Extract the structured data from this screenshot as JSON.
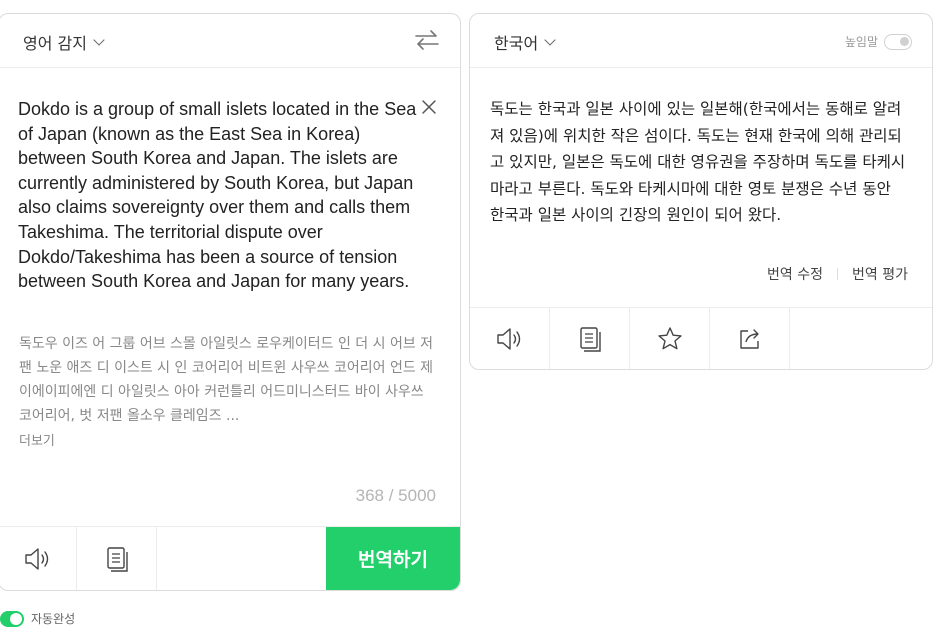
{
  "source_panel": {
    "language_label": "영어 감지",
    "text": "Dokdo is a group of small islets located in the Sea of Japan (known as the East Sea in Korea) between South Korea and Japan. The islets are currently administered by South Korea, but Japan also claims sovereignty over them and calls them Takeshima. The territorial dispute over Dokdo/Takeshima has been a source of tension between South Korea and Japan for many years.",
    "pronunciation": "독도우 이즈 어 그룹 어브 스몰 아일릿스 로우케이터드 인 더 시 어브 저팬 노운 애즈 디 이스트 시 인 코어리어 비트윈 사우쓰 코어리어 언드 제이에이피에엔 디 아일릿스 아아 커런틀리 어드미니스터드 바이 사우쓰 코어리어, 벗 저팬 올소우 클레임즈 ...",
    "more_label": "더보기",
    "char_count": "368 / 5000",
    "translate_button": "번역하기"
  },
  "target_panel": {
    "language_label": "한국어",
    "honorific_label": "높임말",
    "honorific_on": false,
    "text": "독도는 한국과 일본 사이에 있는 일본해(한국에서는 동해로 알려져 있음)에 위치한 작은 섬이다. 독도는 현재 한국에 의해 관리되고 있지만, 일본은 독도에 대한 영유권을 주장하며 독도를 타케시마라고 부른다. 독도와 타케시마에 대한 영토 분쟁은 수년 동안 한국과 일본 사이의 긴장의 원인이 되어 왔다.",
    "edit_label": "번역 수정",
    "rate_label": "번역 평가"
  },
  "autocomplete": {
    "label": "자동완성",
    "on": true
  },
  "colors": {
    "accent": "#22cf6b",
    "border": "#dcdcdc",
    "muted_text": "#888888"
  },
  "icons": [
    "chevron-down-icon",
    "swap-icon",
    "close-icon",
    "speaker-icon",
    "copy-icon",
    "star-icon",
    "share-icon"
  ]
}
